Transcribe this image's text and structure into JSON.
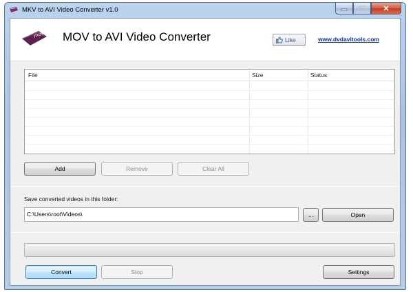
{
  "window": {
    "title": "MKV to AVI Video Converter v1.0",
    "buttons": {
      "minimize": "–",
      "maximize": "□",
      "close": "✕"
    }
  },
  "header": {
    "logo_text": "mov",
    "app_title": "MOV to AVI Video Converter",
    "like_label": "Like",
    "site_link": "www.dvdavitools.com"
  },
  "file_list": {
    "columns": [
      "File",
      "Size",
      "Status"
    ],
    "rows": []
  },
  "list_buttons": {
    "add": "Add",
    "remove": "Remove",
    "clear_all": "Clear All"
  },
  "output": {
    "label": "Save converted videos in this folder:",
    "path": "C:\\Users\\root\\Videos\\",
    "browse": "...",
    "open": "Open"
  },
  "progress": {
    "value": 0
  },
  "actions": {
    "convert": "Convert",
    "stop": "Stop",
    "settings": "Settings"
  },
  "colors": {
    "link": "#0b2b9a",
    "like": "#3b5998",
    "logo": "#6b2a5c"
  }
}
